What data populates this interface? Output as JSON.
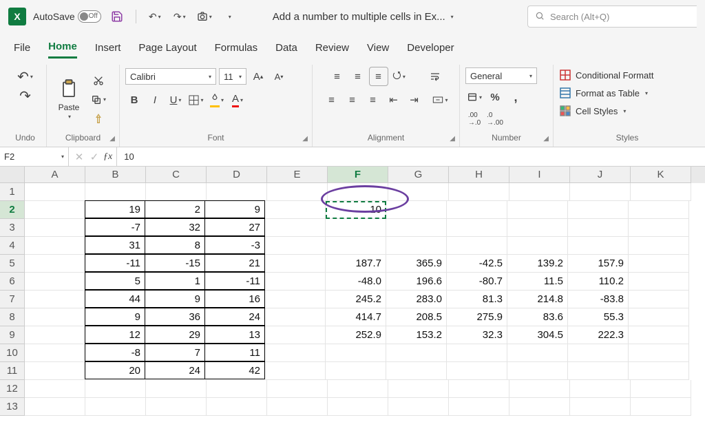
{
  "titlebar": {
    "autosave_label": "AutoSave",
    "autosave_state": "Off",
    "doc_title": "Add a number to multiple cells in Ex...",
    "search_placeholder": "Search (Alt+Q)"
  },
  "tabs": [
    "File",
    "Home",
    "Insert",
    "Page Layout",
    "Formulas",
    "Data",
    "Review",
    "View",
    "Developer"
  ],
  "active_tab": 1,
  "ribbon": {
    "undo_label": "Undo",
    "clipboard_label": "Clipboard",
    "paste_label": "Paste",
    "font_label": "Font",
    "font_name": "Calibri",
    "font_size": "11",
    "alignment_label": "Alignment",
    "number_label": "Number",
    "number_format": "General",
    "styles_label": "Styles",
    "cond_fmt": "Conditional Formatt",
    "fmt_table": "Format as Table",
    "cell_styles": "Cell Styles"
  },
  "namebox": "F2",
  "formula": "10",
  "columns": [
    "A",
    "B",
    "C",
    "D",
    "E",
    "F",
    "G",
    "H",
    "I",
    "J",
    "K"
  ],
  "active_col": "F",
  "active_row": 2,
  "row_count": 13,
  "cells": {
    "B2": "19",
    "C2": "2",
    "D2": "9",
    "F2": "10",
    "B3": "-7",
    "C3": "32",
    "D3": "27",
    "B4": "31",
    "C4": "8",
    "D4": "-3",
    "B5": "-11",
    "C5": "-15",
    "D5": "21",
    "F5": "187.7",
    "G5": "365.9",
    "H5": "-42.5",
    "I5": "139.2",
    "J5": "157.9",
    "B6": "5",
    "C6": "1",
    "D6": "-11",
    "F6": "-48.0",
    "G6": "196.6",
    "H6": "-80.7",
    "I6": "11.5",
    "J6": "110.2",
    "B7": "44",
    "C7": "9",
    "D7": "16",
    "F7": "245.2",
    "G7": "283.0",
    "H7": "81.3",
    "I7": "214.8",
    "J7": "-83.8",
    "B8": "9",
    "C8": "36",
    "D8": "24",
    "F8": "414.7",
    "G8": "208.5",
    "H8": "275.9",
    "I8": "83.6",
    "J8": "55.3",
    "B9": "12",
    "C9": "29",
    "D9": "13",
    "F9": "252.9",
    "G9": "153.2",
    "H9": "32.3",
    "I9": "304.5",
    "J9": "222.3",
    "B10": "-8",
    "C10": "7",
    "D10": "11",
    "B11": "20",
    "C11": "24",
    "D11": "42"
  },
  "bordered_range": {
    "cols": [
      "B",
      "C",
      "D"
    ],
    "rows": [
      2,
      3,
      4,
      5,
      6,
      7,
      8,
      9,
      10,
      11
    ]
  }
}
